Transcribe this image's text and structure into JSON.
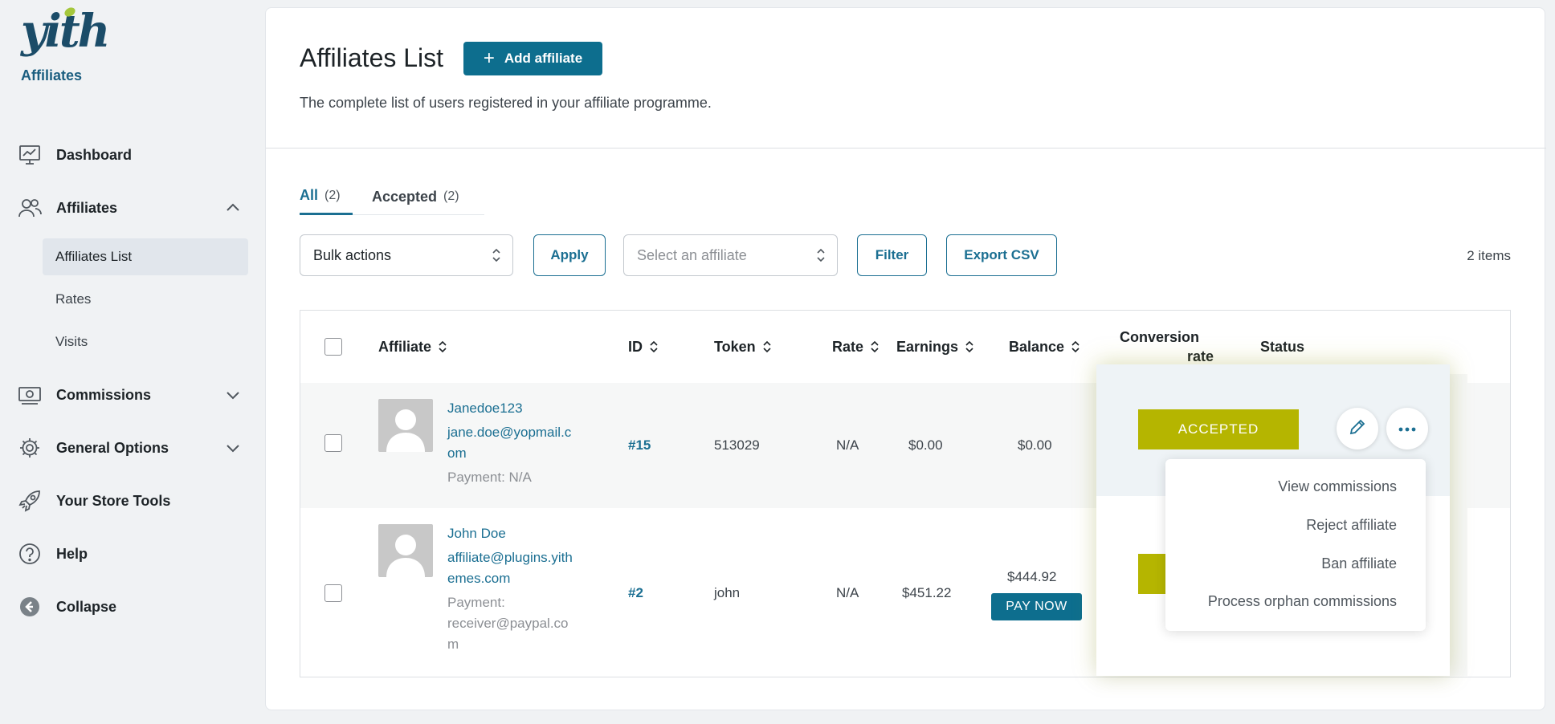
{
  "brand": {
    "logo_text": "yith",
    "subtitle": "Affiliates"
  },
  "sidebar": {
    "items": [
      {
        "label": "Dashboard",
        "icon": "chart-icon"
      },
      {
        "label": "Affiliates",
        "icon": "users-icon"
      },
      {
        "label": "Commissions",
        "icon": "money-icon"
      },
      {
        "label": "General Options",
        "icon": "gear-icon"
      },
      {
        "label": "Your Store Tools",
        "icon": "rocket-icon"
      },
      {
        "label": "Help",
        "icon": "help-icon"
      },
      {
        "label": "Collapse",
        "icon": "collapse-icon"
      }
    ],
    "sub_items": [
      "Affiliates List",
      "Rates",
      "Visits"
    ]
  },
  "header": {
    "title": "Affiliates List",
    "add_button": "Add affiliate",
    "description": "The complete list of users registered in your affiliate programme."
  },
  "tabs": [
    {
      "label": "All",
      "count": "(2)"
    },
    {
      "label": "Accepted",
      "count": "(2)"
    }
  ],
  "toolbar": {
    "bulk_actions": "Bulk actions",
    "apply": "Apply",
    "affiliate_select": "Select an affiliate",
    "filter": "Filter",
    "export": "Export CSV",
    "items_count": "2 items"
  },
  "table": {
    "columns": {
      "affiliate": "Affiliate",
      "id": "ID",
      "token": "Token",
      "rate": "Rate",
      "earnings": "Earnings",
      "balance": "Balance",
      "conversion_line1": "Conversion",
      "conversion_line2": "rate",
      "status": "Status"
    },
    "rows": [
      {
        "name": "Janedoe123",
        "email_line1": "jane.doe@yopmail.c",
        "email_line2": "om",
        "payment_line1": "Payment: N/A",
        "id": "#15",
        "token": "513029",
        "rate": "N/A",
        "earnings": "$0.00",
        "balance": "$0.00"
      },
      {
        "name": "John Doe",
        "email_line1": "affiliate@plugins.yith",
        "email_line2": "emes.com",
        "payment_line1": "Payment:",
        "payment_line2": "receiver@paypal.co",
        "payment_line3": "m",
        "id": "#2",
        "token": "john",
        "rate": "N/A",
        "earnings": "$451.22",
        "balance": "$444.92",
        "pay_button": "PAY NOW"
      }
    ]
  },
  "status_panel": {
    "status": "ACCEPTED",
    "menu": [
      "View commissions",
      "Reject affiliate",
      "Ban affiliate",
      "Process orphan commissions"
    ]
  },
  "colors": {
    "primary": "#0d6e8e",
    "accepted": "#b5b500",
    "accent_green": "#a5c73c"
  }
}
